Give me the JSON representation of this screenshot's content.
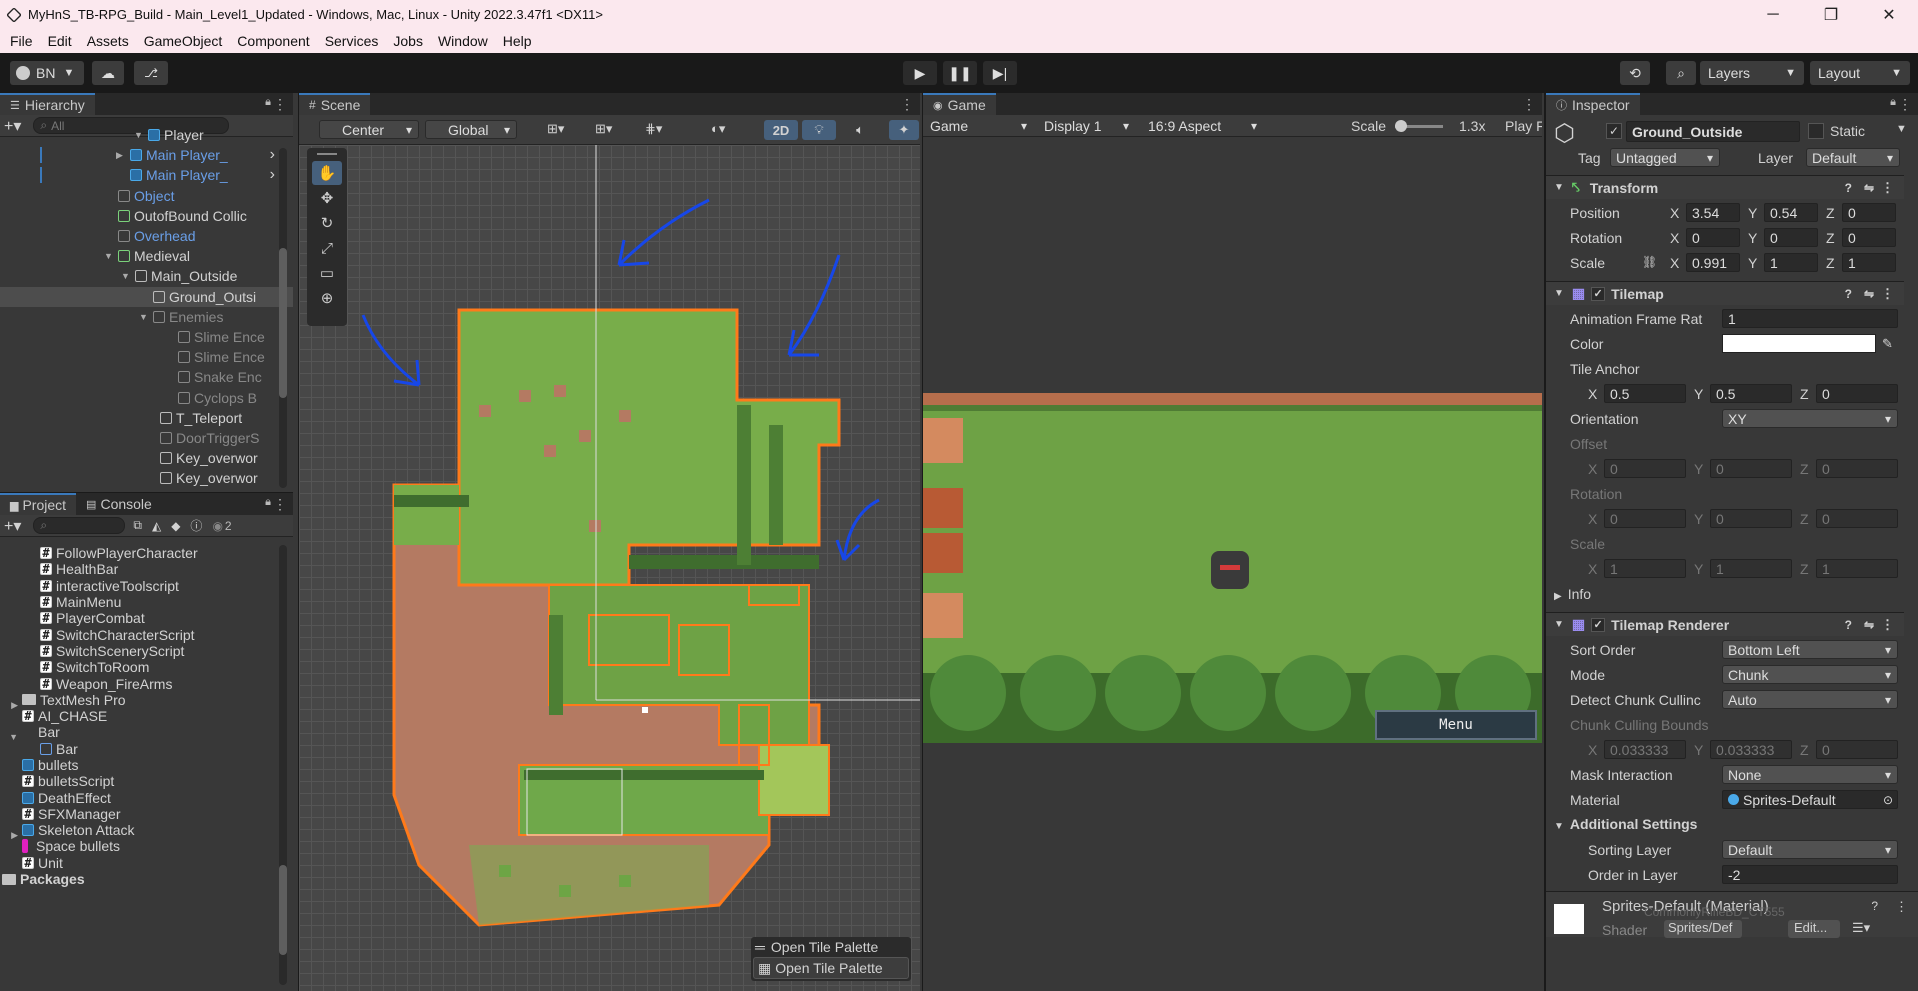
{
  "window": {
    "title": "MyHnS_TB-RPG_Build - Main_Level1_Updated - Windows, Mac, Linux - Unity 2022.3.47f1 <DX11>",
    "minimize": "─",
    "maximize": "❐",
    "close": "✕"
  },
  "menu": [
    "File",
    "Edit",
    "Assets",
    "GameObject",
    "Component",
    "Services",
    "Jobs",
    "Window",
    "Help"
  ],
  "toolbar": {
    "account": "BN",
    "layers": "Layers",
    "layout": "Layout"
  },
  "hierarchy": {
    "tab": "Hierarchy",
    "search_placeholder": "All",
    "rows": [
      {
        "label": "Player",
        "indent": 150,
        "icon": "cube-blue",
        "style": "normal"
      },
      {
        "label": "Main Player_",
        "indent": 132,
        "icon": "cube-blue",
        "style": "blue"
      },
      {
        "label": "Main Player_",
        "indent": 132,
        "icon": "cube-blue",
        "style": "blue"
      },
      {
        "label": "Object",
        "indent": 120,
        "icon": "cube-grey",
        "style": "blue"
      },
      {
        "label": "OutofBound Collic",
        "indent": 120,
        "icon": "cube-green",
        "style": "normal"
      },
      {
        "label": "Overhead",
        "indent": 120,
        "icon": "cube-grey",
        "style": "blue"
      },
      {
        "label": "Medieval",
        "indent": 120,
        "icon": "cube-green",
        "style": "normal"
      },
      {
        "label": "Main_Outside",
        "indent": 137,
        "icon": "cube",
        "style": "normal"
      },
      {
        "label": "Ground_Outsi",
        "indent": 155,
        "icon": "cube",
        "style": "selected"
      },
      {
        "label": "Enemies",
        "indent": 155,
        "icon": "cube-grey",
        "style": "grey"
      },
      {
        "label": "Slime Ence",
        "indent": 180,
        "icon": "cube-grey",
        "style": "grey"
      },
      {
        "label": "Slime Ence",
        "indent": 180,
        "icon": "cube-grey",
        "style": "grey"
      },
      {
        "label": "Snake Enc",
        "indent": 180,
        "icon": "cube-grey",
        "style": "grey"
      },
      {
        "label": "Cyclops B",
        "indent": 180,
        "icon": "cube-grey",
        "style": "grey"
      },
      {
        "label": "T_Teleport",
        "indent": 162,
        "icon": "cube",
        "style": "normal"
      },
      {
        "label": "DoorTriggerS",
        "indent": 162,
        "icon": "cube-grey",
        "style": "grey"
      },
      {
        "label": "Key_overwor",
        "indent": 162,
        "icon": "cube",
        "style": "normal"
      },
      {
        "label": "Key_overwor",
        "indent": 162,
        "icon": "cube",
        "style": "normal"
      }
    ]
  },
  "project": {
    "tab_project": "Project",
    "tab_console": "Console",
    "hidden_count": "2",
    "rows": [
      {
        "label": "FollowPlayerCharacter",
        "type": "script",
        "indent": 58
      },
      {
        "label": "HealthBar",
        "type": "script",
        "indent": 58
      },
      {
        "label": "interactiveToolscript",
        "type": "script",
        "indent": 58
      },
      {
        "label": "MainMenu",
        "type": "script",
        "indent": 58
      },
      {
        "label": "PlayerCombat",
        "type": "script",
        "indent": 58
      },
      {
        "label": "SwitchCharacterScript",
        "type": "script",
        "indent": 58
      },
      {
        "label": "SwitchSceneryScript",
        "type": "script",
        "indent": 58
      },
      {
        "label": "SwitchToRoom",
        "type": "script",
        "indent": 58
      },
      {
        "label": "Weapon_FireArms",
        "type": "script",
        "indent": 58
      },
      {
        "label": "TextMesh Pro",
        "type": "folder",
        "indent": 40
      },
      {
        "label": "AI_CHASE",
        "type": "script",
        "indent": 40
      },
      {
        "label": "Bar",
        "type": "prefab-grey",
        "indent": 40
      },
      {
        "label": "Bar",
        "type": "sprite",
        "indent": 58
      },
      {
        "label": "bullets",
        "type": "prefab",
        "indent": 40
      },
      {
        "label": "bulletsScript",
        "type": "script",
        "indent": 40
      },
      {
        "label": "DeathEffect",
        "type": "prefab",
        "indent": 40
      },
      {
        "label": "SFXManager",
        "type": "script",
        "indent": 40
      },
      {
        "label": "Skeleton Attack",
        "type": "prefab",
        "indent": 40
      },
      {
        "label": "Space bullets",
        "type": "magenta",
        "indent": 40
      },
      {
        "label": "Unit",
        "type": "script",
        "indent": 40
      },
      {
        "label": "Packages",
        "type": "folder",
        "indent": 20
      }
    ]
  },
  "scene": {
    "tab": "Scene",
    "pivot": "Center",
    "space": "Global",
    "mode_2d": "2D",
    "tile_palette_1": "Open Tile Palette",
    "tile_palette_2": "Open Tile Palette"
  },
  "game": {
    "tab": "Game",
    "view": "Game",
    "display": "Display 1",
    "aspect": "16:9 Aspect",
    "scale_label": "Scale",
    "scale_value": "1.3x",
    "play": "Play F",
    "menu_button": "Menu"
  },
  "inspector": {
    "tab": "Inspector",
    "object_name": "Ground_Outside",
    "static": "Static",
    "tag_label": "Tag",
    "tag_value": "Untagged",
    "layer_label": "Layer",
    "layer_value": "Default",
    "transform": {
      "title": "Transform",
      "position_label": "Position",
      "position": {
        "x": "3.54",
        "y": "0.54",
        "z": "0"
      },
      "rotation_label": "Rotation",
      "rotation": {
        "x": "0",
        "y": "0",
        "z": "0"
      },
      "scale_label": "Scale",
      "scale": {
        "x": "0.991",
        "y": "1",
        "z": "1"
      }
    },
    "tilemap": {
      "title": "Tilemap",
      "anim_label": "Animation Frame Rat",
      "anim_value": "1",
      "color_label": "Color",
      "anchor_label": "Tile Anchor",
      "anchor": {
        "x": "0.5",
        "y": "0.5",
        "z": "0"
      },
      "orientation_label": "Orientation",
      "orientation_value": "XY",
      "offset_label": "Offset",
      "offset": {
        "x": "0",
        "y": "0",
        "z": "0"
      },
      "rotation_label": "Rotation",
      "rotation": {
        "x": "0",
        "y": "0",
        "z": "0"
      },
      "scale_label": "Scale",
      "scale": {
        "x": "1",
        "y": "1",
        "z": "1"
      },
      "info_label": "Info"
    },
    "renderer": {
      "title": "Tilemap Renderer",
      "sort_label": "Sort Order",
      "sort_value": "Bottom Left",
      "mode_label": "Mode",
      "mode_value": "Chunk",
      "detect_label": "Detect Chunk Cullinc",
      "detect_value": "Auto",
      "bounds_label": "Chunk Culling Bounds",
      "bounds": {
        "x": "0.033333",
        "y": "0.033333",
        "z": "0"
      },
      "mask_label": "Mask Interaction",
      "mask_value": "None",
      "material_label": "Material",
      "material_value": "Sprites-Default",
      "additional_label": "Additional Settings",
      "sorting_layer_label": "Sorting Layer",
      "sorting_layer_value": "Default",
      "order_label": "Order in Layer",
      "order_value": "-2"
    },
    "material_footer": {
      "name": "Sprites-Default (Material)",
      "shader_label": "Shader",
      "shader_value": "Sprites/Def",
      "edit": "Edit...",
      "overlay": "CommonlyRifleBD_CT555"
    }
  },
  "colors": {
    "accent": "#3a79bb",
    "grass": "#6da545",
    "dirt": "#b97a60",
    "orange_outline": "#ff7a1a",
    "annotation_blue": "#1747e8"
  }
}
